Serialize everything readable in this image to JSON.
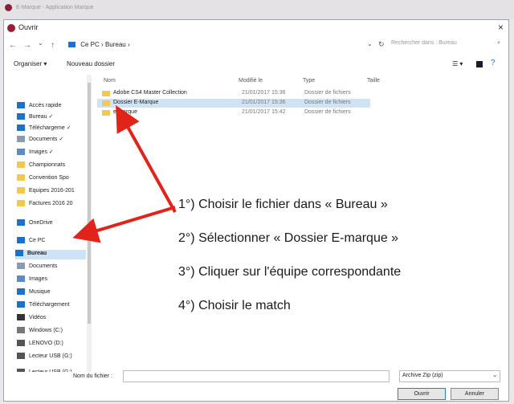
{
  "outer": {
    "title": "E-Marque - Application Marque"
  },
  "dialog": {
    "title": "Ouvrir",
    "close": "×"
  },
  "nav": {
    "back": "←",
    "forward": "→",
    "up_chevron": "⌄",
    "up": "↑",
    "path": [
      "Ce PC",
      "›",
      "Bureau",
      "›"
    ],
    "dropdown": "⌄",
    "refresh": "↻",
    "search_placeholder": "Rechercher dans : Bureau"
  },
  "toolbar": {
    "organize": "Organiser ▾",
    "new_folder": "Nouveau dossier",
    "view": "☰ ▾"
  },
  "sidebar": {
    "items": [
      {
        "label": "Accès rapide",
        "icon": "star-icon",
        "color": "#1a73c8"
      },
      {
        "label": "Bureau ✓",
        "icon": "desktop-icon",
        "color": "#1a73c8"
      },
      {
        "label": "Téléchargeme ✓",
        "icon": "download-icon",
        "color": "#1a73c8"
      },
      {
        "label": "Documents ✓",
        "icon": "document-icon",
        "color": "#8a9bb0"
      },
      {
        "label": "Images ✓",
        "icon": "image-icon",
        "color": "#5a8ac8"
      },
      {
        "label": "Championnats",
        "icon": "folder-icon",
        "color": "#f2c94c"
      },
      {
        "label": "Convention Spo",
        "icon": "folder-icon",
        "color": "#f2c94c"
      },
      {
        "label": "Equipes 2016-201",
        "icon": "folder-icon",
        "color": "#f2c94c"
      },
      {
        "label": "Factures 2016 20",
        "icon": "folder-icon",
        "color": "#f2c94c"
      },
      {
        "label": "OneDrive",
        "icon": "cloud-icon",
        "color": "#1a73c8"
      },
      {
        "label": "Ce PC",
        "icon": "computer-icon",
        "color": "#1a73c8"
      },
      {
        "label": "Bureau",
        "icon": "desktop-icon",
        "color": "#1a73c8"
      },
      {
        "label": "Documents",
        "icon": "document-icon",
        "color": "#8a9bb0"
      },
      {
        "label": "Images",
        "icon": "image-icon",
        "color": "#5a8ac8"
      },
      {
        "label": "Musique",
        "icon": "music-icon",
        "color": "#1a73c8"
      },
      {
        "label": "Téléchargement",
        "icon": "download-icon",
        "color": "#1a73c8"
      },
      {
        "label": "Vidéos",
        "icon": "video-icon",
        "color": "#333333"
      },
      {
        "label": "Windows (C:)",
        "icon": "drive-icon",
        "color": "#777777"
      },
      {
        "label": "LENOVO (D:)",
        "icon": "drive-icon",
        "color": "#555555"
      },
      {
        "label": "Lecteur USB (G:)",
        "icon": "usb-drive-icon",
        "color": "#555555"
      },
      {
        "label": "Lecteur USB (G:)",
        "icon": "usb-drive-icon",
        "color": "#555555"
      }
    ]
  },
  "columns": {
    "name": "Nom",
    "modified": "Modifié le",
    "type": "Type",
    "size": "Taille"
  },
  "files": [
    {
      "name": "Adobe CS4 Master Collection",
      "date": "21/01/2017 15:36",
      "type": "Dossier de fichiers"
    },
    {
      "name": "Dossier E-Marque",
      "date": "21/01/2017 15:36",
      "type": "Dossier de fichiers"
    },
    {
      "name": "e-marque",
      "date": "21/01/2017 15:42",
      "type": "Dossier de fichiers"
    }
  ],
  "bottom": {
    "filename_label": "Nom du fichier :",
    "filter": "Archive Zip (zip)",
    "open": "Ouvrir",
    "cancel": "Annuler"
  },
  "instructions": [
    "1°) Choisir le fichier dans « Bureau »",
    "2°) Sélectionner « Dossier E-marque »",
    "3°) Cliquer sur l'équipe correspondante",
    "4°) Choisir le match"
  ],
  "colors": {
    "arrow": "#e2231a",
    "selection": "#cfe3f7",
    "accent": "#1a73c8"
  }
}
